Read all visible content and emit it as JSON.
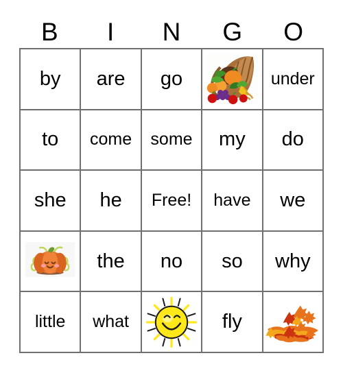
{
  "card": {
    "title": "BINGO",
    "header_letters": [
      "B",
      "I",
      "N",
      "G",
      "O"
    ],
    "border_color": "#6f6f6f",
    "text_color": "#000000",
    "background_color": "#ffffff",
    "rows": [
      [
        {
          "type": "text",
          "label": "by"
        },
        {
          "type": "text",
          "label": "are"
        },
        {
          "type": "text",
          "label": "go"
        },
        {
          "type": "image",
          "label": "cornucopia-image"
        },
        {
          "type": "text",
          "label": "under"
        }
      ],
      [
        {
          "type": "text",
          "label": "to"
        },
        {
          "type": "text",
          "label": "come"
        },
        {
          "type": "text",
          "label": "some"
        },
        {
          "type": "text",
          "label": "my"
        },
        {
          "type": "text",
          "label": "do"
        }
      ],
      [
        {
          "type": "text",
          "label": "she"
        },
        {
          "type": "text",
          "label": "he"
        },
        {
          "type": "text",
          "label": "Free!"
        },
        {
          "type": "text",
          "label": "have"
        },
        {
          "type": "text",
          "label": "we"
        }
      ],
      [
        {
          "type": "image",
          "label": "pumpkin-image"
        },
        {
          "type": "text",
          "label": "the"
        },
        {
          "type": "text",
          "label": "no"
        },
        {
          "type": "text",
          "label": "so"
        },
        {
          "type": "text",
          "label": "why"
        }
      ],
      [
        {
          "type": "text",
          "label": "little"
        },
        {
          "type": "text",
          "label": "what"
        },
        {
          "type": "image",
          "label": "sun-image"
        },
        {
          "type": "text",
          "label": "fly"
        },
        {
          "type": "image",
          "label": "autumn-leaves-image"
        }
      ]
    ],
    "art_colors": {
      "cornucopia_horn": "#8b5a2b",
      "pumpkin_orange": "#e8732a",
      "grape_purple": "#6b2d8c",
      "apple_red": "#cc1111",
      "corn_yellow": "#f2c21e",
      "leaf_green": "#3f8f2a",
      "sun_yellow": "#ffe81a",
      "leaves_orange": "#e8731c",
      "leaves_red": "#cc3311",
      "leaves_gold": "#f3a81c",
      "pumpkin_tile_bg": "#f7f7f7"
    }
  }
}
